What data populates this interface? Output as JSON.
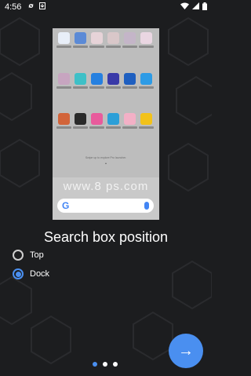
{
  "status_bar": {
    "time": "4:56",
    "left_icons": [
      "sync-icon",
      "download-icon"
    ],
    "right_icons": [
      "wifi-icon",
      "signal-icon",
      "battery-icon"
    ]
  },
  "preview": {
    "hint_line1": "Swipe up to explore Pro launcher.",
    "hint_line2": "▲",
    "watermark": "www.8  ps.com",
    "search_logo": "G"
  },
  "screen_title": "Search box position",
  "options": [
    {
      "label": "Top",
      "selected": false
    },
    {
      "label": "Dock",
      "selected": true
    }
  ],
  "pager": {
    "count": 3,
    "active_index": 0
  },
  "next_button": {
    "icon": "arrow-right-icon",
    "glyph": "→"
  },
  "colors": {
    "accent": "#4a8ff0",
    "background": "#1c1d1f",
    "preview_bg": "#bdbdbd"
  }
}
